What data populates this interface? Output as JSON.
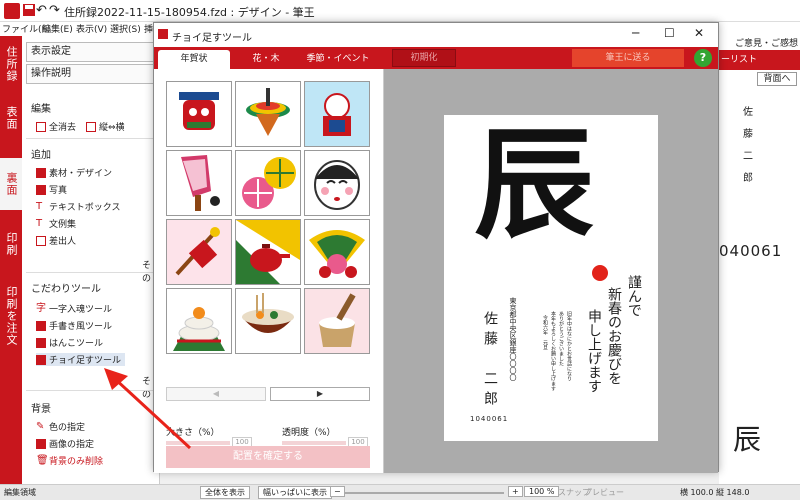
{
  "window": {
    "title": "住所録2022-11-15-180954.fzd : デザイン - 筆王"
  },
  "menu": [
    "ファイル(F)",
    "編集(E)",
    "表示(V)",
    "選択(S)",
    "挿"
  ],
  "top_right": {
    "feedback": "ご意見・ご感想"
  },
  "left_tabs": [
    "住所録",
    "表面",
    "裏面",
    "印刷",
    "印刷を注文"
  ],
  "left_panel": {
    "display_settings": "表示設定",
    "operation_guide": "操作説明",
    "edit_head": "編集",
    "delete_all": "全消去",
    "vertical_horizontal": "縦⇔横",
    "add_head": "追加",
    "add_items": [
      "素材・デザイン",
      "写真",
      "テキストボックス",
      "文例集",
      "差出人"
    ],
    "other": "その",
    "special_head": "こだわりツール",
    "special_items": [
      "一字入魂ツール",
      "手書き風ツール",
      "はんこツール",
      "チョイ足すツール"
    ],
    "other2": "その",
    "background_head": "背景",
    "background_items": [
      "色の指定",
      "画像の指定",
      "背景のみ削除"
    ]
  },
  "dialog": {
    "title": "チョイ足すツール",
    "tabs": [
      "年賀状",
      "花・木",
      "季節・イベント"
    ],
    "init_button": "初期化",
    "send_button": "筆王に送る",
    "help": "?",
    "size_label": "大きさ（%）",
    "size_value": "100",
    "opacity_label": "透明度（%）",
    "opacity_value": "100",
    "confirm_button": "配置を確定する",
    "nav_prev": "◀",
    "nav_next": "▶"
  },
  "card": {
    "big_char": "辰",
    "greeting": [
      "謹んで",
      "新春のお慶びを",
      "申し上げます"
    ],
    "message": [
      "旧年中はなにかとお世話になり",
      "ありがとうございました",
      "本年もよろしくお願い申し上げます",
      "令和六年　元旦"
    ],
    "address": "東京都中央区銀座〇〇〇〇",
    "name": "佐藤　二郎",
    "postal": "1040061"
  },
  "right_panel": {
    "list_label": "ーリスト",
    "back_button": "背面へ",
    "name_chars": [
      "佐",
      "藤",
      "二",
      "郎"
    ],
    "postal": "040061",
    "big_char": "辰"
  },
  "status": {
    "area": "編集領域",
    "fit_all": "全体を表示",
    "fit_width": "幅いっぱいに表示",
    "minus": "−",
    "plus": "+",
    "zoom": "100 %",
    "snap": "スナップ",
    "preview": "プレビュー",
    "size": "横 100.0 縦 148.0"
  },
  "colors": {
    "brand_red": "#c8161d",
    "send_green": "#33a532"
  }
}
